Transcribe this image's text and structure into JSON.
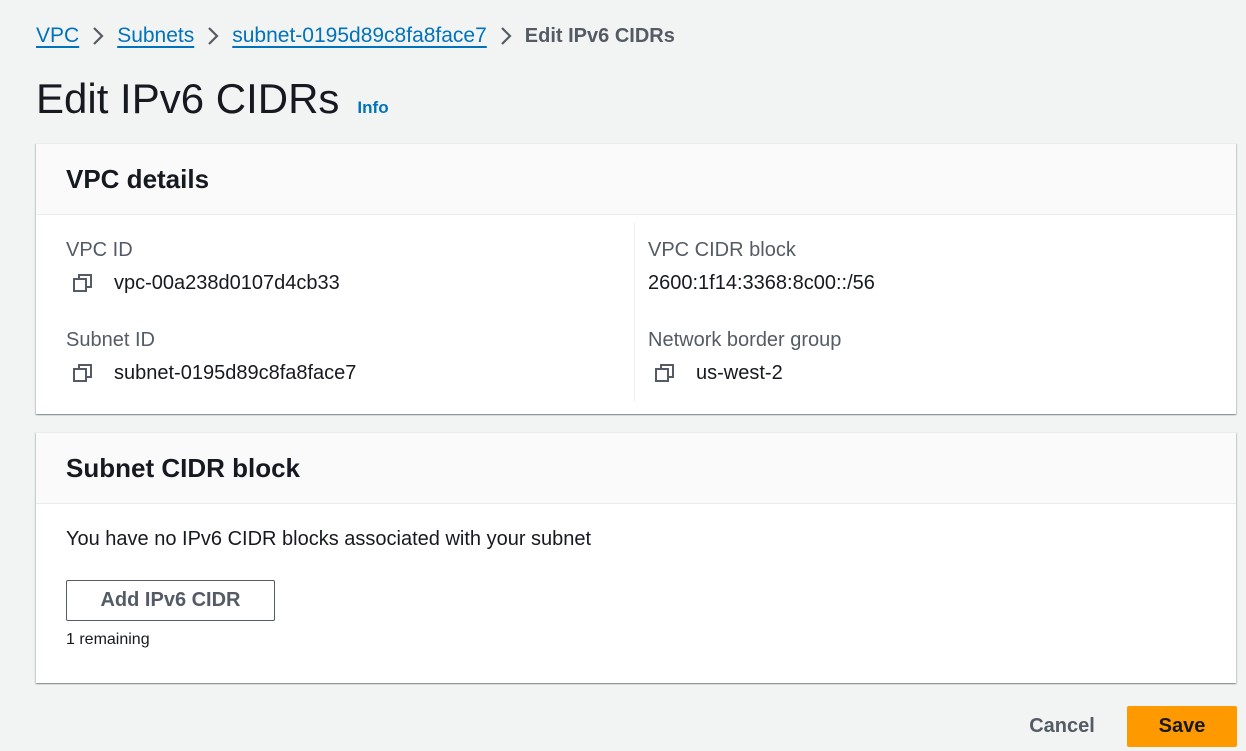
{
  "breadcrumb": {
    "items": [
      "VPC",
      "Subnets",
      "subnet-0195d89c8fa8face7"
    ],
    "current": "Edit IPv6 CIDRs"
  },
  "header": {
    "title": "Edit IPv6 CIDRs",
    "info_label": "Info"
  },
  "vpc_details": {
    "heading": "VPC details",
    "vpc_id_label": "VPC ID",
    "vpc_id_value": "vpc-00a238d0107d4cb33",
    "subnet_id_label": "Subnet ID",
    "subnet_id_value": "subnet-0195d89c8fa8face7",
    "vpc_cidr_label": "VPC CIDR block",
    "vpc_cidr_value": "2600:1f14:3368:8c00::/56",
    "border_group_label": "Network border group",
    "border_group_value": "us-west-2"
  },
  "subnet_cidr": {
    "heading": "Subnet CIDR block",
    "message": "You have no IPv6 CIDR blocks associated with your subnet",
    "add_button_label": "Add IPv6 CIDR",
    "remaining_text": "1 remaining"
  },
  "actions": {
    "cancel_label": "Cancel",
    "save_label": "Save"
  },
  "colors": {
    "link": "#0073bb",
    "primary_button": "#ff9900",
    "background": "#f2f3f3"
  },
  "icons": [
    "chevron-right-icon",
    "copy-icon"
  ]
}
